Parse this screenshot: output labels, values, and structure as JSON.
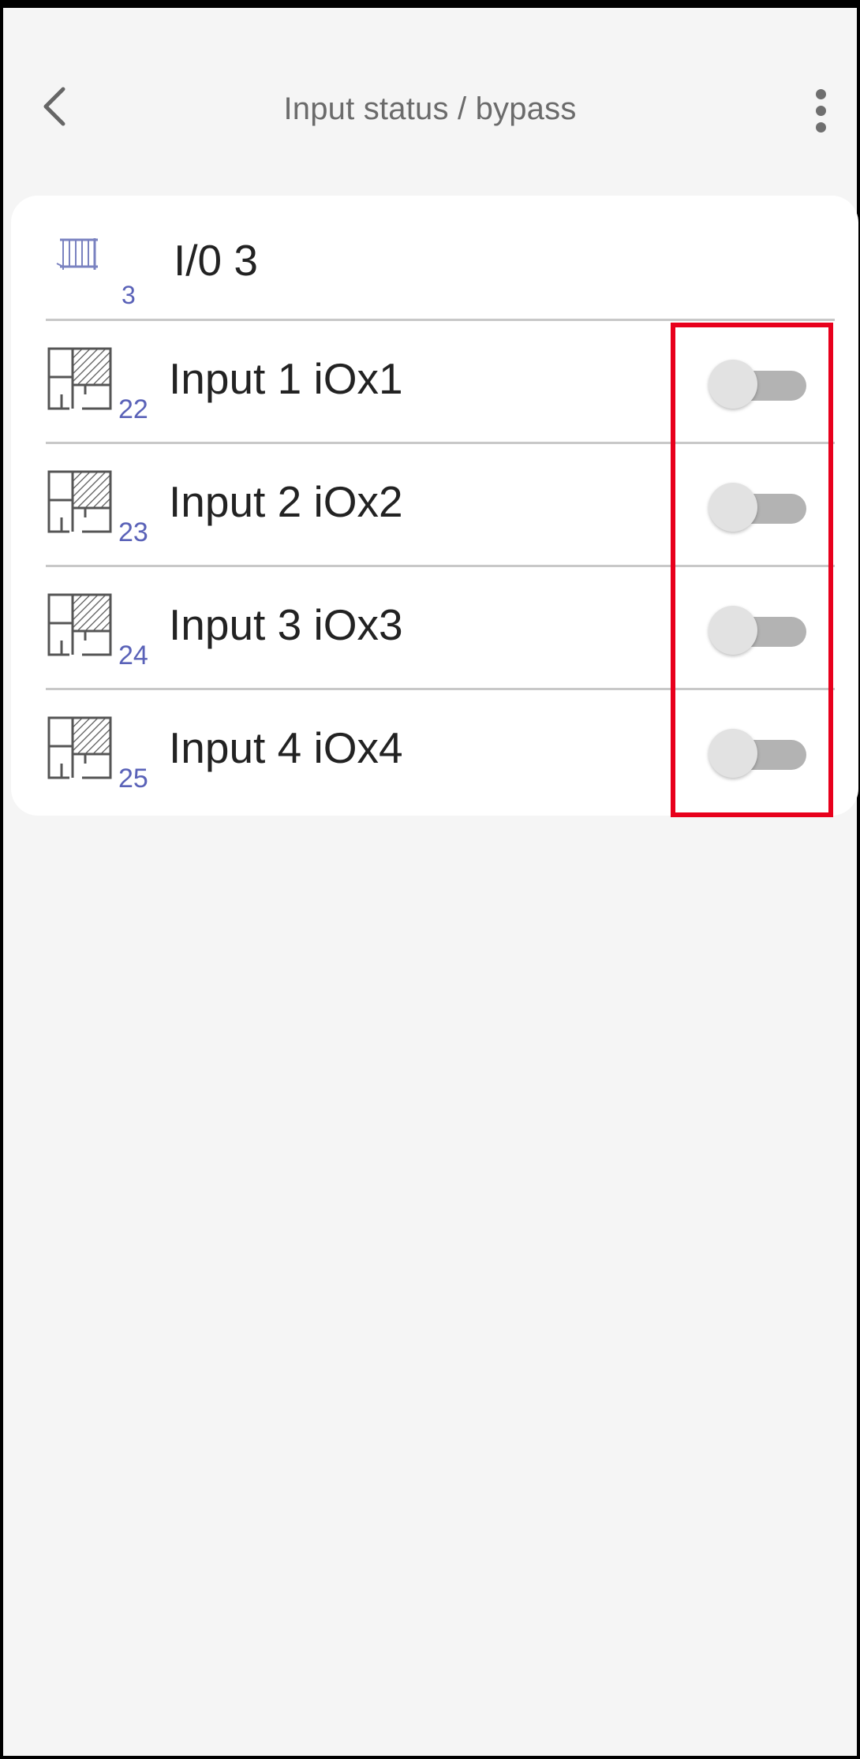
{
  "header": {
    "title": "Input status / bypass",
    "back_icon": "chevron-left-icon",
    "menu_icon": "more-vertical-icon"
  },
  "group": {
    "icon": "gate-icon",
    "number": "3",
    "label": "I/0 3"
  },
  "inputs": [
    {
      "number": "22",
      "label": "Input 1 iOx1",
      "icon": "zone-floorplan-icon",
      "bypass": false
    },
    {
      "number": "23",
      "label": "Input 2 iOx2",
      "icon": "zone-floorplan-icon",
      "bypass": false
    },
    {
      "number": "24",
      "label": "Input 3 iOx3",
      "icon": "zone-floorplan-icon",
      "bypass": false
    },
    {
      "number": "25",
      "label": "Input 4 iOx4",
      "icon": "zone-floorplan-icon",
      "bypass": false
    }
  ],
  "colors": {
    "background": "#f5f5f5",
    "card": "#ffffff",
    "accent_number": "#5a62b8",
    "toggle_track_off": "#b3b3b3",
    "toggle_thumb_off": "#e2e2e2",
    "highlight": "#e8001c"
  }
}
